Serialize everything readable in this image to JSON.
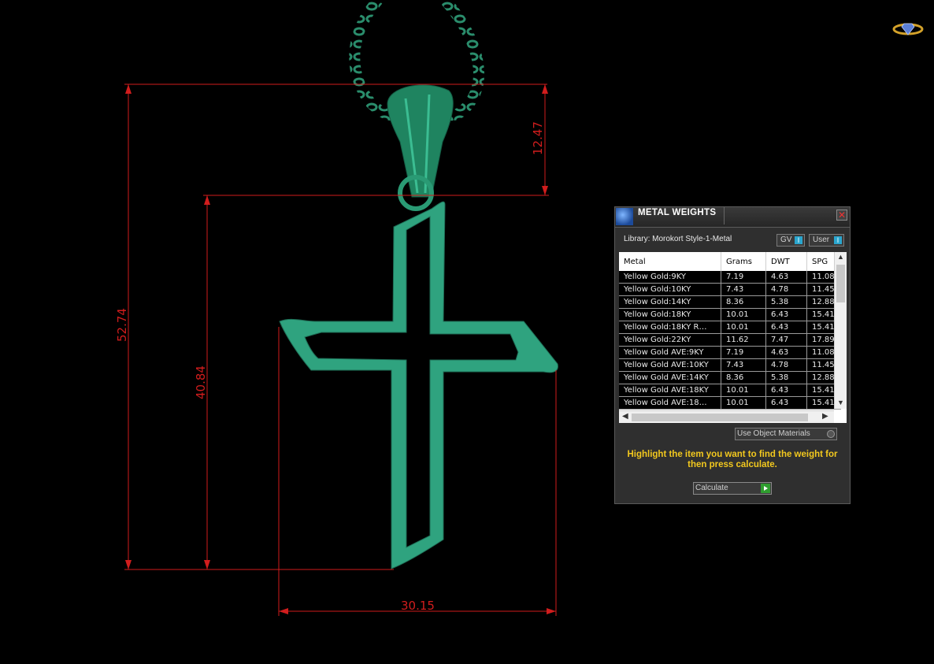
{
  "viewport": {
    "dimensions": {
      "overall_height": "52.74",
      "cross_height": "40.84",
      "bail_height": "12.47",
      "width": "30.15"
    },
    "colors": {
      "model": "#2fa37f",
      "dimension_line": "#d11d1d"
    }
  },
  "panel": {
    "title": "METAL WEIGHTS",
    "close_label": "✕",
    "library_label": "Library: Morokort Style-1-Metal",
    "toggles": {
      "gv_label": "GV",
      "user_label": "User",
      "knob_label": "I"
    },
    "table": {
      "headers": [
        "Metal",
        "Grams",
        "DWT",
        "SPG"
      ],
      "rows": [
        [
          "Yellow Gold:9KY",
          "7.19",
          "4.63",
          "11.08"
        ],
        [
          "Yellow Gold:10KY",
          "7.43",
          "4.78",
          "11.45"
        ],
        [
          "Yellow Gold:14KY",
          "8.36",
          "5.38",
          "12.88"
        ],
        [
          "Yellow Gold:18KY",
          "10.01",
          "6.43",
          "15.41"
        ],
        [
          "Yellow Gold:18KY R…",
          "10.01",
          "6.43",
          "15.41"
        ],
        [
          "Yellow Gold:22KY",
          "11.62",
          "7.47",
          "17.89"
        ],
        [
          "Yellow Gold AVE:9KY",
          "7.19",
          "4.63",
          "11.08"
        ],
        [
          "Yellow Gold AVE:10KY",
          "7.43",
          "4.78",
          "11.45"
        ],
        [
          "Yellow Gold AVE:14KY",
          "8.36",
          "5.38",
          "12.88"
        ],
        [
          "Yellow Gold AVE:18KY",
          "10.01",
          "6.43",
          "15.41"
        ],
        [
          "Yellow Gold AVE:18…",
          "10.01",
          "6.43",
          "15.41"
        ]
      ]
    },
    "use_object_materials": "Use Object Materials",
    "instruction": "Highlight the item you want to find the weight for then press calculate.",
    "calculate_label": "Calculate",
    "accent": "#2aa6ce",
    "instruction_color": "#f2c81e"
  }
}
